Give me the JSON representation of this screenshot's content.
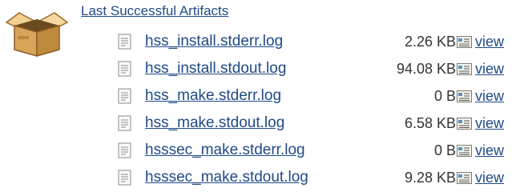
{
  "section": {
    "title": "Last Successful Artifacts"
  },
  "colors": {
    "link": "#204a87",
    "size_text": "#333333"
  },
  "icons": {
    "section": "package-box-icon",
    "file": "text-file-icon",
    "view": "view-document-icon"
  },
  "artifacts": [
    {
      "name": "hss_install.stderr.log",
      "size": "2.26 KB",
      "action": "view"
    },
    {
      "name": "hss_install.stdout.log",
      "size": "94.08 KB",
      "action": "view"
    },
    {
      "name": "hss_make.stderr.log",
      "size": "0 B",
      "action": "view"
    },
    {
      "name": "hss_make.stdout.log",
      "size": "6.58 KB",
      "action": "view"
    },
    {
      "name": "hsssec_make.stderr.log",
      "size": "0 B",
      "action": "view"
    },
    {
      "name": "hsssec_make.stdout.log",
      "size": "9.28 KB",
      "action": "view"
    }
  ]
}
